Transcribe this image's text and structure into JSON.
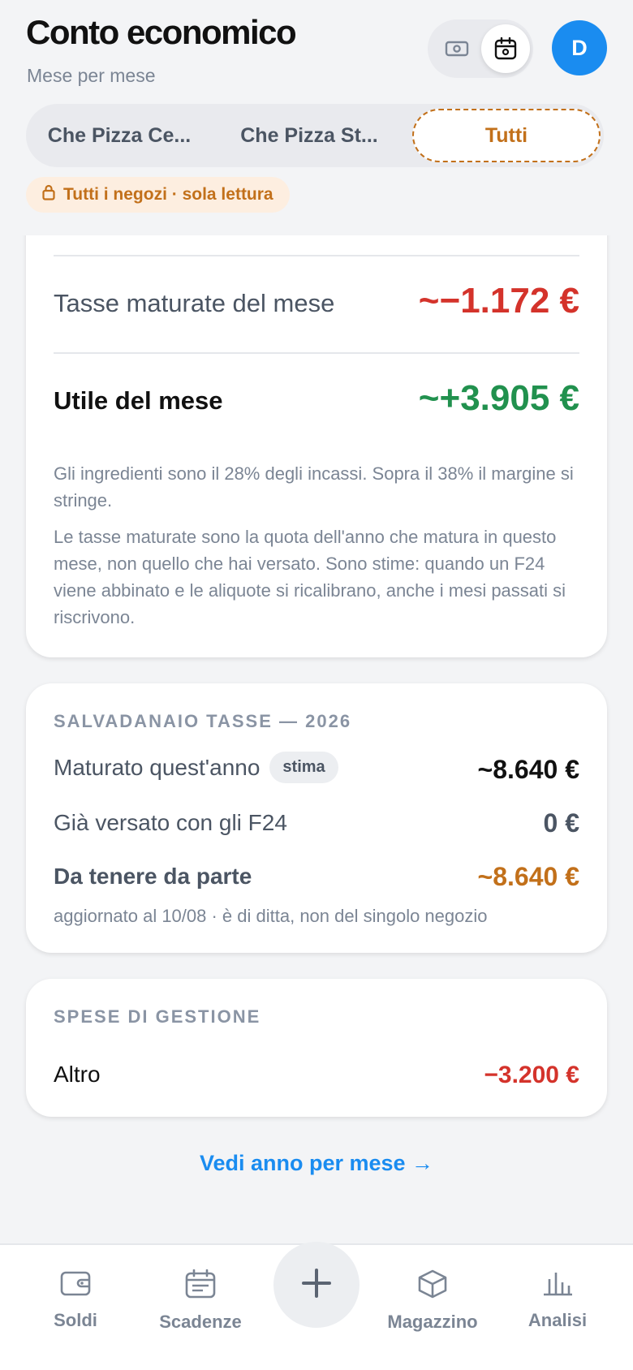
{
  "header": {
    "title": "Conto economico",
    "subtitle": "Mese per mese",
    "avatar_initial": "D",
    "view_toggle": {
      "left_icon": "banknote-icon",
      "right_icon": "calendar-icon",
      "selected": "calendar"
    }
  },
  "store_tabs": [
    {
      "label": "Che Pizza Ce...",
      "selected": false
    },
    {
      "label": "Che Pizza St...",
      "selected": false
    },
    {
      "label": "Tutti",
      "selected": true
    }
  ],
  "readonly_badge": {
    "icon": "lock-icon",
    "label": "Tutti i negozi · sola lettura"
  },
  "month_card": {
    "taxes_label": "Tasse maturate del mese",
    "taxes_value": "~−1.172 €",
    "profit_label": "Utile del mese",
    "profit_value": "~+3.905 €",
    "note_1": "Gli ingredienti sono il 28% degli incassi. Sopra il 38% il margine si stringe.",
    "note_2": "Le tasse maturate sono la quota dell'anno che matura in questo mese, non quello che hai versato. Sono stime: quando un F24 viene abbinato e le aliquote si ricalibrano, anche i mesi passati si riscrivono."
  },
  "tax_box": {
    "title": "SALVADANAIO TASSE — 2026",
    "accrued_label": "Maturato quest'anno",
    "accrued_badge": "stima",
    "accrued_value": "~8.640 €",
    "paid_label": "Già versato con gli F24",
    "paid_value": "0 €",
    "keep_label": "Da tenere da parte",
    "keep_value": "~8.640 €",
    "footnote": "aggiornato al 10/08 · è di ditta, non del singolo negozio"
  },
  "expenses": {
    "title": "SPESE DI GESTIONE",
    "items": [
      {
        "label": "Altro",
        "value": "−3.200 €"
      }
    ]
  },
  "year_link": "Vedi anno per mese →",
  "bottom_nav": [
    {
      "label": "Soldi",
      "icon": "wallet-icon"
    },
    {
      "label": "Scadenze",
      "icon": "calendar-list-icon"
    },
    {
      "label": "",
      "icon": "plus-icon"
    },
    {
      "label": "Magazzino",
      "icon": "box-icon"
    },
    {
      "label": "Analisi",
      "icon": "bar-chart-icon"
    }
  ],
  "colors": {
    "accent_blue": "#1a8cf0",
    "negative_red": "#d4332b",
    "positive_green": "#21914e",
    "warning_orange": "#c2701a"
  }
}
